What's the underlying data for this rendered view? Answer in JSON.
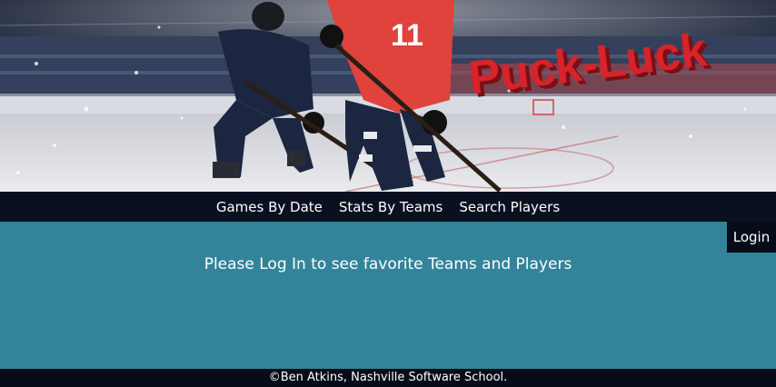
{
  "brand": {
    "logo_text": "Puck-Luck"
  },
  "nav": {
    "items": [
      {
        "label": "Games By Date"
      },
      {
        "label": "Stats By Teams"
      },
      {
        "label": "Search Players"
      }
    ]
  },
  "auth": {
    "login_label": "Login"
  },
  "main": {
    "message": "Please Log In to see favorite Teams and Players"
  },
  "footer": {
    "text": "©Ben Atkins, Nashville Software School."
  },
  "hero": {
    "player_number": "11"
  },
  "colors": {
    "nav_bg": "#0b1020",
    "main_bg": "#33849b",
    "footer_bg": "#060b18",
    "logo_red": "#d8232a",
    "jersey_red": "#e0423c",
    "jersey_navy": "#1c2640"
  }
}
